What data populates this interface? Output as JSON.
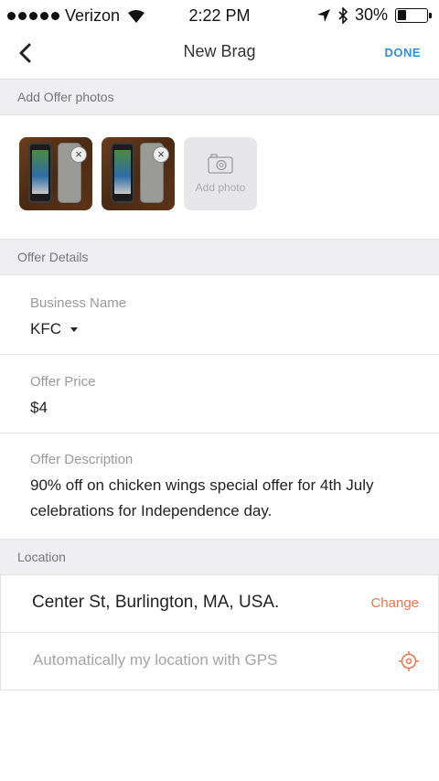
{
  "status_bar": {
    "carrier": "Verizon",
    "time": "2:22 PM",
    "battery": "30%",
    "battery_level": 0.3
  },
  "nav": {
    "title": "New Brag",
    "done_label": "DONE"
  },
  "photos_section": {
    "header": "Add Offer photos",
    "add_photo_label": "Add photo"
  },
  "details_section": {
    "header": "Offer Details",
    "business_name": {
      "label": "Business Name",
      "value": "KFC"
    },
    "offer_price": {
      "label": "Offer Price",
      "value": "$4"
    },
    "offer_description": {
      "label": "Offer Description",
      "value": "90% off on chicken wings special offer for 4th July celebrations for Independence day."
    }
  },
  "location_section": {
    "header": "Location",
    "address": "Center St, Burlington, MA, USA.",
    "change_label": "Change",
    "gps_label": "Automatically my location with GPS"
  },
  "colors": {
    "accent_blue": "#2f8fd8",
    "accent_orange": "#e7754d"
  }
}
